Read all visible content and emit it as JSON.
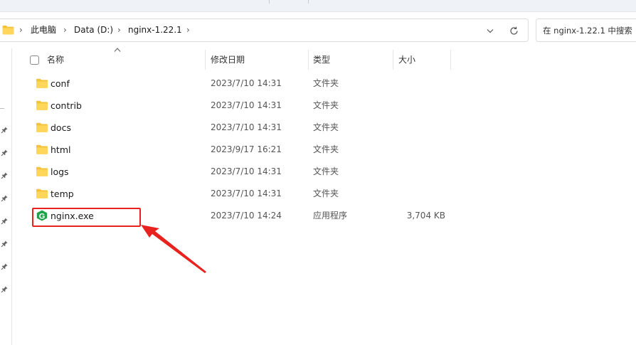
{
  "breadcrumb": {
    "items": [
      {
        "label": "此电脑"
      },
      {
        "label": "Data (D:)"
      },
      {
        "label": "nginx-1.22.1"
      }
    ]
  },
  "search": {
    "placeholder": "在 nginx-1.22.1 中搜索"
  },
  "columns": {
    "name": "名称",
    "date": "修改日期",
    "type": "类型",
    "size": "大小"
  },
  "files": [
    {
      "name": "conf",
      "date": "2023/7/10 14:31",
      "type": "文件夹",
      "size": "",
      "icon": "folder-icon"
    },
    {
      "name": "contrib",
      "date": "2023/7/10 14:31",
      "type": "文件夹",
      "size": "",
      "icon": "folder-icon"
    },
    {
      "name": "docs",
      "date": "2023/7/10 14:31",
      "type": "文件夹",
      "size": "",
      "icon": "folder-icon"
    },
    {
      "name": "html",
      "date": "2023/9/17 16:21",
      "type": "文件夹",
      "size": "",
      "icon": "folder-icon"
    },
    {
      "name": "logs",
      "date": "2023/7/10 14:31",
      "type": "文件夹",
      "size": "",
      "icon": "folder-icon"
    },
    {
      "name": "temp",
      "date": "2023/7/10 14:31",
      "type": "文件夹",
      "size": "",
      "icon": "folder-icon"
    },
    {
      "name": "nginx.exe",
      "date": "2023/7/10 14:24",
      "type": "应用程序",
      "size": "3,704 KB",
      "icon": "nginx-app-icon"
    }
  ],
  "colors": {
    "folder": "#f5c33b",
    "nginx": "#1fa34a",
    "annotation": "#e8231f"
  },
  "icons": [
    "folder-icon",
    "chevron-right-icon",
    "chevron-down-icon",
    "refresh-icon",
    "pin-icon",
    "sort-up-icon",
    "nginx-app-icon",
    "annotation-arrow"
  ]
}
